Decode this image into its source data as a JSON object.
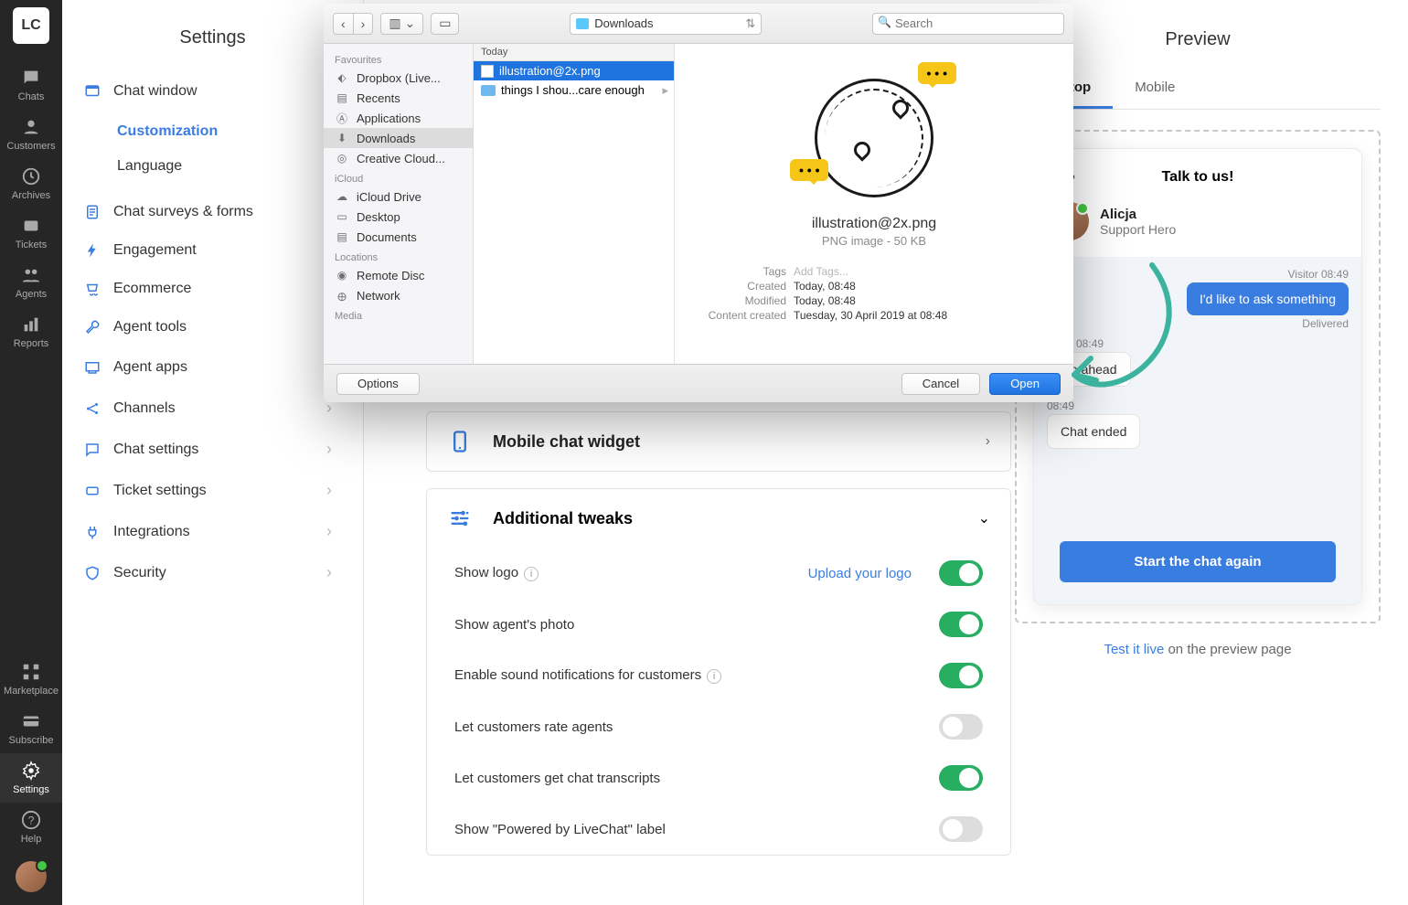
{
  "rail": {
    "logo": "LC",
    "items": [
      {
        "label": "Chats",
        "icon": "chat"
      },
      {
        "label": "Customers",
        "icon": "user"
      },
      {
        "label": "Archives",
        "icon": "clock"
      },
      {
        "label": "Tickets",
        "icon": "ticket"
      },
      {
        "label": "Agents",
        "icon": "agents"
      },
      {
        "label": "Reports",
        "icon": "reports"
      }
    ],
    "bottom": [
      {
        "label": "Marketplace",
        "icon": "grid"
      },
      {
        "label": "Subscribe",
        "icon": "card"
      },
      {
        "label": "Settings",
        "icon": "gear",
        "active": true
      },
      {
        "label": "Help",
        "icon": "help"
      }
    ]
  },
  "sidebar": {
    "title": "Settings",
    "nav": [
      {
        "label": "Chat window",
        "icon": "window",
        "expanded": true,
        "children": [
          {
            "label": "Customization",
            "active": true
          },
          {
            "label": "Language"
          }
        ]
      },
      {
        "label": "Chat surveys & forms",
        "icon": "form"
      },
      {
        "label": "Engagement",
        "icon": "lightning"
      },
      {
        "label": "Ecommerce",
        "icon": "cart"
      },
      {
        "label": "Agent tools",
        "icon": "wrench"
      },
      {
        "label": "Agent apps",
        "icon": "apps",
        "has_caret": true
      },
      {
        "label": "Channels",
        "icon": "share",
        "has_caret": true
      },
      {
        "label": "Chat settings",
        "icon": "chatset",
        "has_caret": true
      },
      {
        "label": "Ticket settings",
        "icon": "ticketset",
        "has_caret": true
      },
      {
        "label": "Integrations",
        "icon": "plug",
        "has_caret": true
      },
      {
        "label": "Security",
        "icon": "shield",
        "has_caret": true
      }
    ]
  },
  "main": {
    "mobile_card": "Mobile chat widget",
    "tweaks_card": "Additional tweaks",
    "upload_link": "Upload your logo",
    "tweaks": [
      {
        "label": "Show logo",
        "info": true,
        "link": true,
        "on": true
      },
      {
        "label": "Show agent's photo",
        "on": true
      },
      {
        "label": "Enable sound notifications for customers",
        "info": true,
        "on": true
      },
      {
        "label": "Let customers rate agents",
        "on": false
      },
      {
        "label": "Let customers get chat transcripts",
        "on": true
      },
      {
        "label": "Show \"Powered by LiveChat\" label",
        "on": false
      }
    ]
  },
  "preview": {
    "title": "Preview",
    "tabs": [
      {
        "label": "Desktop",
        "active": true
      },
      {
        "label": "Mobile"
      }
    ],
    "chat": {
      "header_dots": "•••",
      "title": "Talk to us!",
      "agent_name": "Alicja",
      "agent_role": "Support Hero",
      "visitor_meta": "Visitor 08:49",
      "visitor_msg": "I'd like to ask something",
      "delivered": "Delivered",
      "agent_meta": "Alicja 08:49",
      "agent_msg": "Go ahead",
      "end_meta": "08:49",
      "end_msg": "Chat ended",
      "button": "Start the chat again"
    },
    "link_text": "Test it live",
    "link_rest": " on the preview page"
  },
  "dialog": {
    "location": "Downloads",
    "search_placeholder": "Search",
    "sidebar_sections": [
      {
        "title": "Favourites",
        "items": [
          {
            "label": "Dropbox (Live...",
            "icon": "dropbox"
          },
          {
            "label": "Recents",
            "icon": "recents"
          },
          {
            "label": "Applications",
            "icon": "apps"
          },
          {
            "label": "Downloads",
            "icon": "download",
            "selected": true
          },
          {
            "label": "Creative Cloud...",
            "icon": "cc"
          }
        ]
      },
      {
        "title": "iCloud",
        "items": [
          {
            "label": "iCloud Drive",
            "icon": "cloud"
          },
          {
            "label": "Desktop",
            "icon": "desktop"
          },
          {
            "label": "Documents",
            "icon": "docs"
          }
        ]
      },
      {
        "title": "Locations",
        "items": [
          {
            "label": "Remote Disc",
            "icon": "disc"
          },
          {
            "label": "Network",
            "icon": "network"
          }
        ]
      },
      {
        "title": "Media",
        "items": []
      }
    ],
    "list_header": "Today",
    "files": [
      {
        "label": "illustration@2x.png",
        "selected": true,
        "type": "file"
      },
      {
        "label": "things I shou...care enough",
        "type": "folder",
        "has_caret": true
      }
    ],
    "file_preview": {
      "name": "illustration@2x.png",
      "type_line": "PNG image - 50 KB",
      "meta": [
        {
          "k": "Tags",
          "v": "Add Tags...",
          "placeholder": true
        },
        {
          "k": "Created",
          "v": "Today, 08:48"
        },
        {
          "k": "Modified",
          "v": "Today, 08:48"
        },
        {
          "k": "Content created",
          "v": "Tuesday, 30 April 2019 at 08:48"
        }
      ]
    },
    "options": "Options",
    "cancel": "Cancel",
    "open": "Open"
  }
}
